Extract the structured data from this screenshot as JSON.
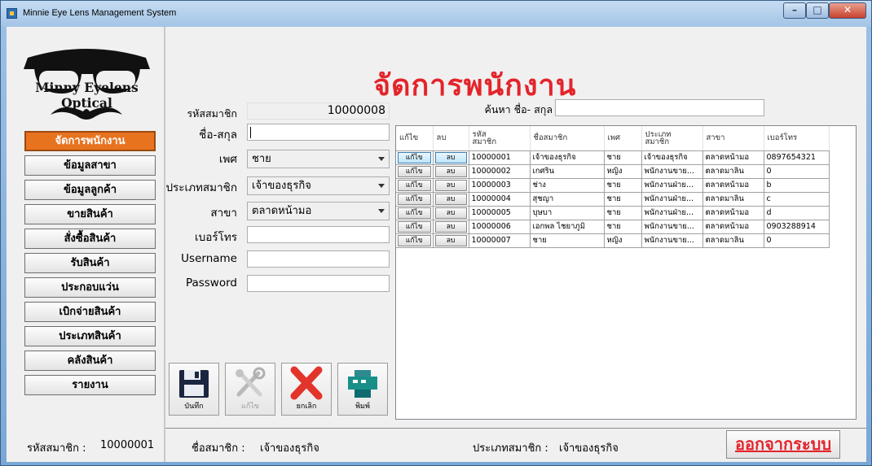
{
  "window": {
    "title": "Minnie Eye Lens Management System"
  },
  "logo": {
    "text": "Minny Eyelens Optical"
  },
  "nav": {
    "items": [
      {
        "label": "จัดการพนักงาน"
      },
      {
        "label": "ข้อมูลสาขา"
      },
      {
        "label": "ข้อมูลลูกค้า"
      },
      {
        "label": "ขายสินค้า"
      },
      {
        "label": "สั่งซื้อสินค้า"
      },
      {
        "label": "รับสินค้า"
      },
      {
        "label": "ประกอบแว่น"
      },
      {
        "label": "เบิกจ่ายสินค้า"
      },
      {
        "label": "ประเภทสินค้า"
      },
      {
        "label": "คลังสินค้า"
      },
      {
        "label": "รายงาน"
      }
    ]
  },
  "page": {
    "title": "จัดการพนักงาน"
  },
  "form": {
    "member_id": {
      "label": "รหัสสมาชิก",
      "value": "10000008"
    },
    "name": {
      "label": "ชื่อ-สกุล",
      "value": ""
    },
    "gender": {
      "label": "เพศ",
      "value": "ชาย"
    },
    "member_type": {
      "label": "ประเภทสมาชิก",
      "value": "เจ้าของธุรกิจ"
    },
    "branch": {
      "label": "สาขา",
      "value": "ตลาดหน้ามอ"
    },
    "phone": {
      "label": "เบอร์โทร",
      "value": ""
    },
    "username": {
      "label": "Username",
      "value": ""
    },
    "password": {
      "label": "Password",
      "value": ""
    }
  },
  "search": {
    "label": "ค้นหา ชื่อ- สกุล",
    "value": ""
  },
  "actions": {
    "save": "บันทึก",
    "edit": "แก้ไข",
    "cancel": "ยกเลิก",
    "print": "พิมพ์"
  },
  "grid": {
    "columns": [
      "แก้ไข",
      "ลบ",
      "รหัส\nสมาชิก",
      "ชื่อสมาชิก",
      "เพศ",
      "ประเภท\nสมาชิก",
      "สาขา",
      "เบอร์โทร"
    ],
    "edit_btn": "แก้ไข",
    "delete_btn": "ลบ",
    "rows": [
      {
        "id": "10000001",
        "name": "เจ้าของธุรกิจ",
        "gender": "ชาย",
        "type": "เจ้าของธุรกิจ",
        "branch": "ตลาดหน้ามอ",
        "phone": "0897654321"
      },
      {
        "id": "10000002",
        "name": "เกศริน",
        "gender": "หญิง",
        "type": "พนักงานขาย...",
        "branch": "ตลาดมาลิน",
        "phone": "0"
      },
      {
        "id": "10000003",
        "name": "ช่าง",
        "gender": "ชาย",
        "type": "พนักงานฝ่าย...",
        "branch": "ตลาดหน้ามอ",
        "phone": "b"
      },
      {
        "id": "10000004",
        "name": "สุชญา",
        "gender": "ชาย",
        "type": "พนักงานฝ่าย...",
        "branch": "ตลาดมาลิน",
        "phone": "c"
      },
      {
        "id": "10000005",
        "name": "บุษบา",
        "gender": "ชาย",
        "type": "พนักงานฝ่าย...",
        "branch": "ตลาดหน้ามอ",
        "phone": "d"
      },
      {
        "id": "10000006",
        "name": "เอกพล ไชยาภูมิ",
        "gender": "ชาย",
        "type": "พนักงานขาย...",
        "branch": "ตลาดหน้ามอ",
        "phone": "0903288914"
      },
      {
        "id": "10000007",
        "name": "ชาย",
        "gender": "หญิง",
        "type": "พนักงานขาย...",
        "branch": "ตลาดมาลิน",
        "phone": "0"
      }
    ]
  },
  "footer": {
    "member_id_label": "รหัสสมาชิก :",
    "member_id_value": "10000001",
    "member_name_label": "ชื่อสมาชิก :",
    "member_name_value": "เจ้าของธุรกิจ",
    "member_type_label": "ประเภทสมาชิก :",
    "member_type_value": "เจ้าของธุรกิจ",
    "logout": "ออกจากระบบ"
  },
  "colors": {
    "accent": "#e8731f",
    "title": "#e3242b"
  }
}
